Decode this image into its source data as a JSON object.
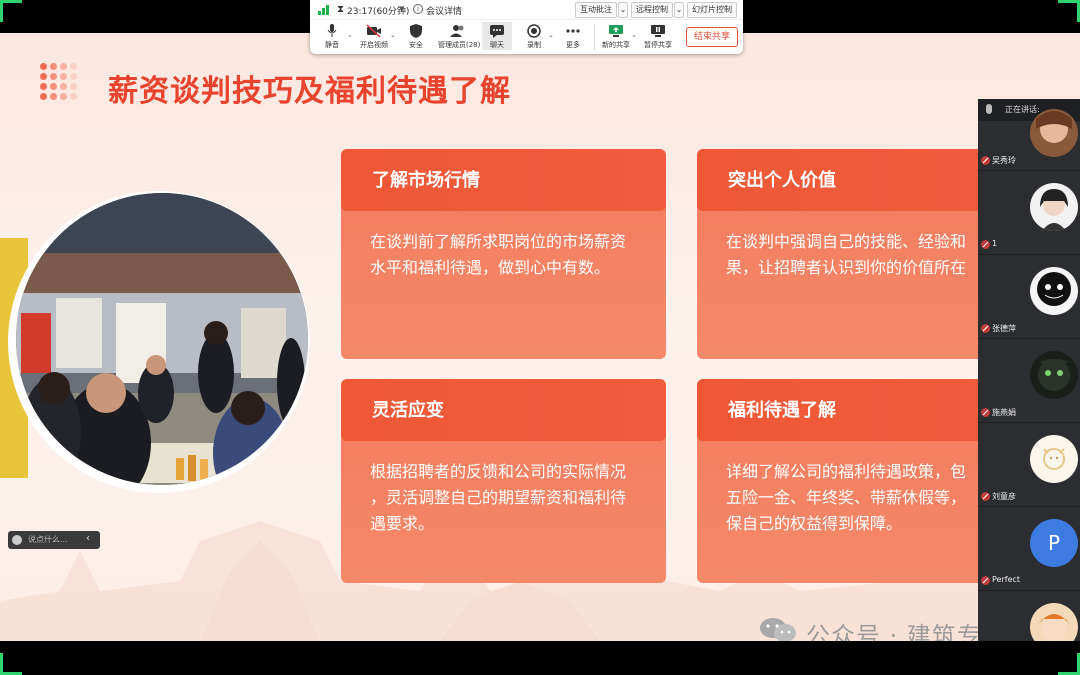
{
  "toolbar": {
    "timer": "23:17(60分钟)",
    "meeting_info": "会议详情",
    "interactive_annotation": "互动批注",
    "remote_control": "远程控制",
    "slide_control": "幻灯片控制",
    "items": [
      {
        "label": "静音"
      },
      {
        "label": "开启视频"
      },
      {
        "label": "安全"
      },
      {
        "label": "管理成员(28)"
      },
      {
        "label": "聊天"
      },
      {
        "label": "录制"
      },
      {
        "label": "更多"
      },
      {
        "label": "新的共享"
      },
      {
        "label": "暂停共享"
      }
    ],
    "end_share": "结束共享"
  },
  "slide": {
    "title": "薪资谈判技巧及福利待遇了解",
    "cards": [
      {
        "title": "了解市场行情",
        "body": [
          "在谈判前了解所求职岗位的市场薪资",
          "水平和福利待遇，做到心中有数。"
        ]
      },
      {
        "title": "突出个人价值",
        "body": [
          "在谈判中强调自己的技能、经验和",
          "果，让招聘者认识到你的价值所在"
        ]
      },
      {
        "title": "灵活应变",
        "body": [
          "根据招聘者的反馈和公司的实际情况",
          "，灵活调整自己的期望薪资和福利待",
          "遇要求。"
        ]
      },
      {
        "title": "福利待遇了解",
        "body": [
          "详细了解公司的福利待遇政策，包",
          "五险一金、年终奖、带薪休假等，",
          "保自己的权益得到保障。"
        ]
      }
    ]
  },
  "chat": {
    "placeholder": "说点什么..."
  },
  "participants": {
    "speaking_label": "正在讲话:",
    "list": [
      {
        "name": "吴秀玲"
      },
      {
        "name": "1"
      },
      {
        "name": "张德萍"
      },
      {
        "name": "施燕娟"
      },
      {
        "name": "刘童彦"
      },
      {
        "name": "Perfect",
        "initial": "P"
      }
    ]
  },
  "watermark": {
    "text": "公众号 · 建筑专语"
  },
  "colors": {
    "accent": "#e8432e",
    "card": "#f47a5e",
    "card_header": "#ee5836",
    "toolbar_green": "#1db14a"
  }
}
